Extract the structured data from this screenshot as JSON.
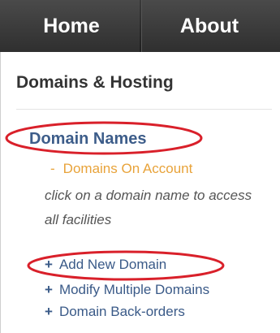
{
  "nav": {
    "items": [
      {
        "label": "Home"
      },
      {
        "label": "About"
      }
    ]
  },
  "sidebar": {
    "section_title": "Domains & Hosting",
    "category": "Domain Names",
    "sub_item": {
      "marker": "-",
      "label": "Domains On Account"
    },
    "instruction": "click on a domain name to access all facilities",
    "links": [
      {
        "marker": "+",
        "label": "Add New Domain"
      },
      {
        "marker": "+",
        "label": "Modify Multiple Domains"
      },
      {
        "marker": "+",
        "label": "Domain Back-orders"
      }
    ]
  },
  "annotations": {
    "color": "#d9202a"
  }
}
